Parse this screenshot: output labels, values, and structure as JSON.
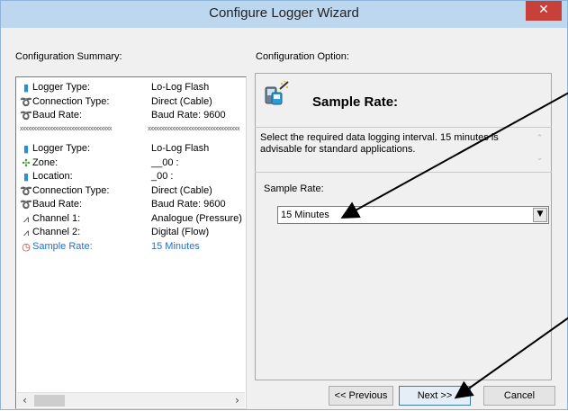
{
  "window": {
    "title": "Configure Logger Wizard",
    "close_glyph": "✕"
  },
  "summary": {
    "label": "Configuration Summary:",
    "separator": "xxxxxxxxxxxxxxxxxxxxxxxxxxxxxxxxxx",
    "rows_a": [
      {
        "icon": "logger-icon",
        "glyph": "▮",
        "label": "Logger Type:",
        "value": "Lo-Log Flash"
      },
      {
        "icon": "cable-icon",
        "glyph": "➰",
        "label": "Connection Type:",
        "value": "Direct (Cable)"
      },
      {
        "icon": "cable-icon",
        "glyph": "➰",
        "label": "Baud Rate:",
        "value": "Baud Rate: 9600"
      }
    ],
    "rows_b": [
      {
        "icon": "logger-icon",
        "glyph": "▮",
        "label": "Logger Type:",
        "value": "Lo-Log Flash"
      },
      {
        "icon": "zone-icon",
        "glyph": "✣",
        "label": "Zone:",
        "value": "__00 :"
      },
      {
        "icon": "logger-icon",
        "glyph": "▮",
        "label": "Location:",
        "value": "_00 :"
      },
      {
        "icon": "cable-icon",
        "glyph": "➰",
        "label": "Connection Type:",
        "value": "Direct (Cable)"
      },
      {
        "icon": "cable-icon",
        "glyph": "➰",
        "label": "Baud Rate:",
        "value": "Baud Rate: 9600"
      },
      {
        "icon": "channel-icon",
        "glyph": "⩘",
        "label": "Channel 1:",
        "value": "Analogue (Pressure)"
      },
      {
        "icon": "channel-icon",
        "glyph": "⩘",
        "label": "Channel 2:",
        "value": "Digital (Flow)"
      },
      {
        "icon": "clock-icon",
        "glyph": "◷",
        "label": "Sample Rate:",
        "value": "15 Minutes",
        "highlight": true
      }
    ]
  },
  "option": {
    "label": "Configuration Option:",
    "heading": "Sample Rate:",
    "description": "Select the required data logging interval. 15 minutes is advisable for standard applications.",
    "field_label": "Sample Rate:",
    "selected_value": "15 Minutes"
  },
  "buttons": {
    "previous": "<< Previous",
    "next": "Next >>",
    "cancel": "Cancel"
  },
  "colors": {
    "title_bar": "#bdd7ee",
    "close": "#c7403a",
    "highlight": "#1f6fd0",
    "background": "#f0f0f0"
  }
}
